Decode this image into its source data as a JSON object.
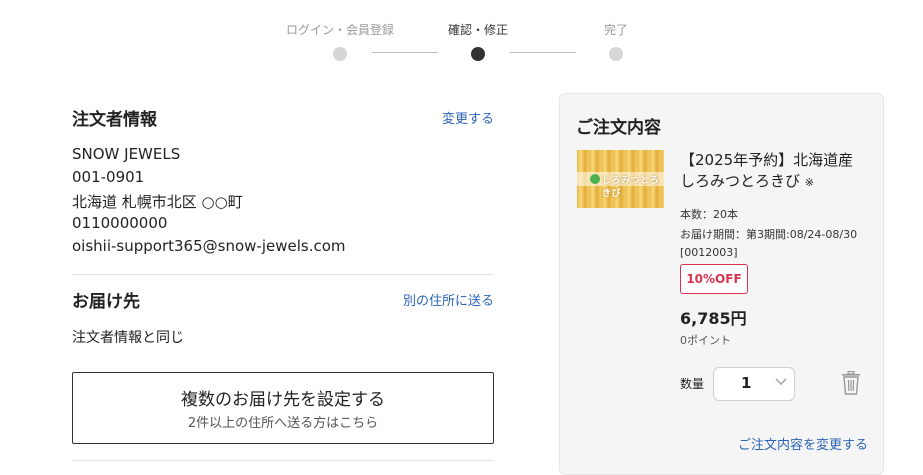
{
  "steps": [
    {
      "label": "ログイン・会員登録",
      "state": "done"
    },
    {
      "label": "確認・修正",
      "state": "current"
    },
    {
      "label": "完了",
      "state": "upcoming"
    }
  ],
  "orderer": {
    "title": "注文者情報",
    "change_link": "変更する",
    "name": "SNOW JEWELS",
    "postal": "001-0901",
    "address": "北海道 札幌市北区 ○○町",
    "phone": "0110000000",
    "email": "oishii-support365@snow-jewels.com"
  },
  "delivery": {
    "title": "お届け先",
    "alt_link": "別の住所に送る",
    "same_text": "注文者情報と同じ"
  },
  "multi_address": {
    "main": "複数のお届け先を設定する",
    "sub": "2件以上の住所へ送る方はこちら"
  },
  "order_summary": {
    "title": "ご注文内容",
    "product": {
      "thumb_logo": "しろみつとろきび",
      "name": "【2025年予約】北海道産 しろみつとろきび",
      "name_mark": "※",
      "count": "本数：20本",
      "delivery_period": "お届け期間：第3期間:08/24-08/30",
      "code": "[0012003]",
      "discount": "10%OFF",
      "price": "6,785円",
      "points": "0ポイント"
    },
    "quantity_label": "数量",
    "quantity_value": "1",
    "change_link": "ご注文内容を変更する"
  },
  "colors": {
    "link": "#2a63b7",
    "discount": "#d9334f",
    "step_active": "#333333",
    "step_inactive": "#d6d6d6"
  },
  "icons": [
    "chevron-down-icon",
    "trash-icon",
    "step-dot-icon"
  ]
}
